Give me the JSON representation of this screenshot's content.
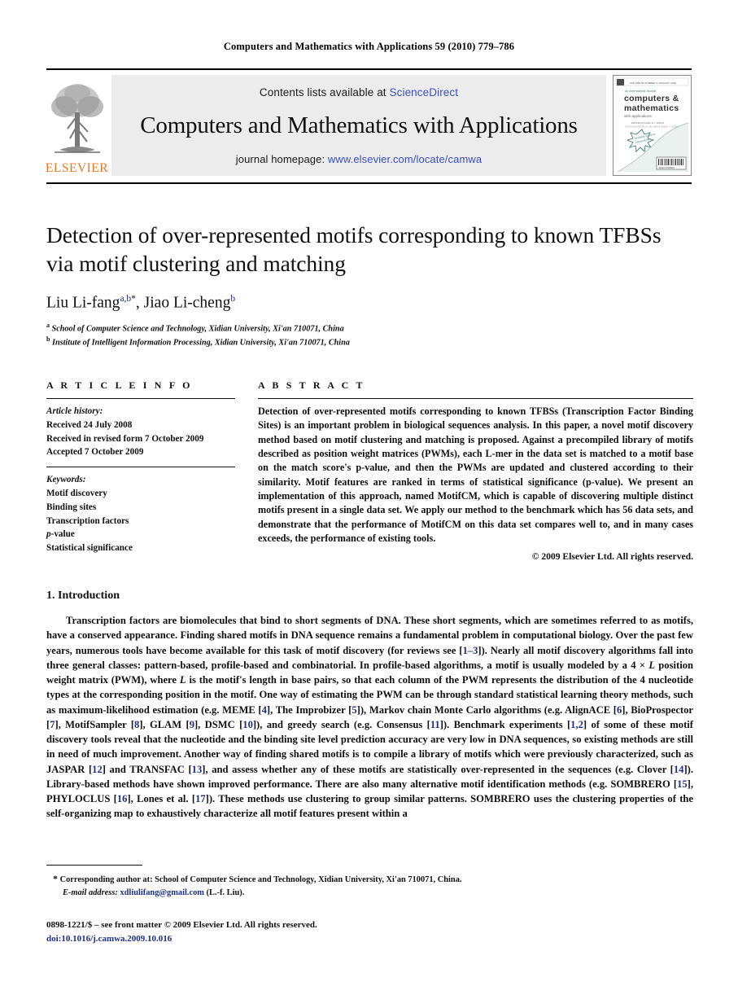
{
  "running_head": "Computers and Mathematics with Applications 59 (2010) 779–786",
  "banner": {
    "contents_prefix": "Contents lists available at ",
    "contents_link": "ScienceDirect",
    "journal_name": "Computers and Mathematics with Applications",
    "homepage_prefix": "journal homepage: ",
    "homepage_link": "www.elsevier.com/locate/camwa",
    "publisher_logo_text": "ELSEVIER",
    "cover": {
      "line1": "An International Journal",
      "line2": "computers &",
      "line3": "mathematics",
      "line4": "with applications",
      "badge": "Available online at",
      "footer": "ELSEVIER"
    },
    "logo_color": "#E87722",
    "link_color": "#3a4fc4",
    "banner_bg": "#ececec"
  },
  "title": "Detection of over-represented motifs corresponding to known TFBSs via motif clustering and matching",
  "authors": {
    "author1_name": "Liu Li-fang",
    "author1_sup": "a,b",
    "author1_star": "*",
    "separator": ", ",
    "author2_name": "Jiao Li-cheng",
    "author2_sup": "b"
  },
  "affiliations": [
    {
      "marker": "a",
      "text": "School of Computer Science and Technology, Xidian University, Xi'an 710071, China"
    },
    {
      "marker": "b",
      "text": "Institute of Intelligent Information Processing, Xidian University, Xi'an 710071, China"
    }
  ],
  "article_info": {
    "heading": "A R T I C L E    I N F O",
    "history_label": "Article history:",
    "history": [
      "Received 24 July 2008",
      "Received in revised form 7 October 2009",
      "Accepted 7 October 2009"
    ],
    "keywords_label": "Keywords:",
    "keywords": [
      "Motif discovery",
      "Binding sites",
      "Transcription factors",
      "p-value",
      "Statistical significance"
    ]
  },
  "abstract": {
    "heading": "A B S T R A C T",
    "text": "Detection of over-represented motifs corresponding to known TFBSs (Transcription Factor Binding Sites) is an important problem in biological sequences analysis. In this paper, a novel motif discovery method based on motif clustering and matching is proposed. Against a precompiled library of motifs described as position weight matrices (PWMs), each L-mer in the data set is matched to a motif base on the match score's p-value, and then the PWMs are updated and clustered according to their similarity. Motif features are ranked in terms of statistical significance (p-value). We present an implementation of this approach, named MotifCM, which is capable of discovering multiple distinct motifs present in a single data set. We apply our method to the benchmark which has 56 data sets, and demonstrate that the performance of MotifCM on this data set compares well to, and in many cases exceeds, the performance of existing tools.",
    "copyright": "© 2009 Elsevier Ltd. All rights reserved."
  },
  "section": {
    "heading": "1.  Introduction",
    "paragraph_parts": [
      {
        "t": "Transcription factors are biomolecules that bind to short segments of DNA. These short segments, which are sometimes referred to as motifs, have a conserved appearance. Finding shared motifs in DNA sequence remains a fundamental problem in computational biology. Over the past few years, numerous tools have become available for this task of motif discovery (for reviews see [",
        "k": "plain"
      },
      {
        "t": "1–3",
        "k": "ref"
      },
      {
        "t": "]). Nearly all motif discovery algorithms fall into three general classes: pattern-based, profile-based and combinatorial. In profile-based algorithms, a motif is usually modeled by a 4 × ",
        "k": "plain"
      },
      {
        "t": "L",
        "k": "em"
      },
      {
        "t": " position weight matrix (PWM), where ",
        "k": "plain"
      },
      {
        "t": "L",
        "k": "em"
      },
      {
        "t": " is the motif's length in base pairs, so that each column of the PWM represents the distribution of the 4 nucleotide types at the corresponding position in the motif. One way of estimating the PWM can be through standard statistical learning theory methods, such as maximum-likelihood estimation (e.g. MEME [",
        "k": "plain"
      },
      {
        "t": "4",
        "k": "ref"
      },
      {
        "t": "], The Improbizer [",
        "k": "plain"
      },
      {
        "t": "5",
        "k": "ref"
      },
      {
        "t": "]), Markov chain Monte Carlo algorithms (e.g. AlignACE [",
        "k": "plain"
      },
      {
        "t": "6",
        "k": "ref"
      },
      {
        "t": "], BioProspector [",
        "k": "plain"
      },
      {
        "t": "7",
        "k": "ref"
      },
      {
        "t": "], MotifSampler [",
        "k": "plain"
      },
      {
        "t": "8",
        "k": "ref"
      },
      {
        "t": "], GLAM [",
        "k": "plain"
      },
      {
        "t": "9",
        "k": "ref"
      },
      {
        "t": "], DSMC [",
        "k": "plain"
      },
      {
        "t": "10",
        "k": "ref"
      },
      {
        "t": "]), and greedy search (e.g. Consensus [",
        "k": "plain"
      },
      {
        "t": "11",
        "k": "ref"
      },
      {
        "t": "]). Benchmark experiments [",
        "k": "plain"
      },
      {
        "t": "1,2",
        "k": "ref"
      },
      {
        "t": "] of some of these motif discovery tools reveal that the nucleotide and the binding site level prediction accuracy are very low in DNA sequences, so existing methods are still in need of much improvement. Another way of finding shared motifs is to compile a library of motifs which were previously characterized, such as JASPAR [",
        "k": "plain"
      },
      {
        "t": "12",
        "k": "ref"
      },
      {
        "t": "] and TRANSFAC [",
        "k": "plain"
      },
      {
        "t": "13",
        "k": "ref"
      },
      {
        "t": "], and assess whether any of these motifs are statistically over-represented in the sequences (e.g. Clover [",
        "k": "plain"
      },
      {
        "t": "14",
        "k": "ref"
      },
      {
        "t": "]). Library-based methods have shown improved performance. There are also many alternative motif identification methods (e.g. SOMBRERO [",
        "k": "plain"
      },
      {
        "t": "15",
        "k": "ref"
      },
      {
        "t": "], PHYLOCLUS [",
        "k": "plain"
      },
      {
        "t": "16",
        "k": "ref"
      },
      {
        "t": "], Lones et al. [",
        "k": "plain"
      },
      {
        "t": "17",
        "k": "ref"
      },
      {
        "t": "]). These methods use clustering to group similar patterns. SOMBRERO uses the clustering properties of the self-organizing map to exhaustively characterize all motif features present within a",
        "k": "plain"
      }
    ]
  },
  "footnote": {
    "star": "*",
    "corresponding": " Corresponding author at: School of Computer Science and Technology, Xidian University, Xi'an 710071, China.",
    "email_label": "E-mail address:",
    "email": "xdliulifang@gmail.com",
    "email_suffix": " (L.-f. Liu)."
  },
  "imprint": {
    "line1": "0898-1221/$ – see front matter © 2009 Elsevier Ltd. All rights reserved.",
    "doi": "doi:10.1016/j.camwa.2009.10.016"
  }
}
